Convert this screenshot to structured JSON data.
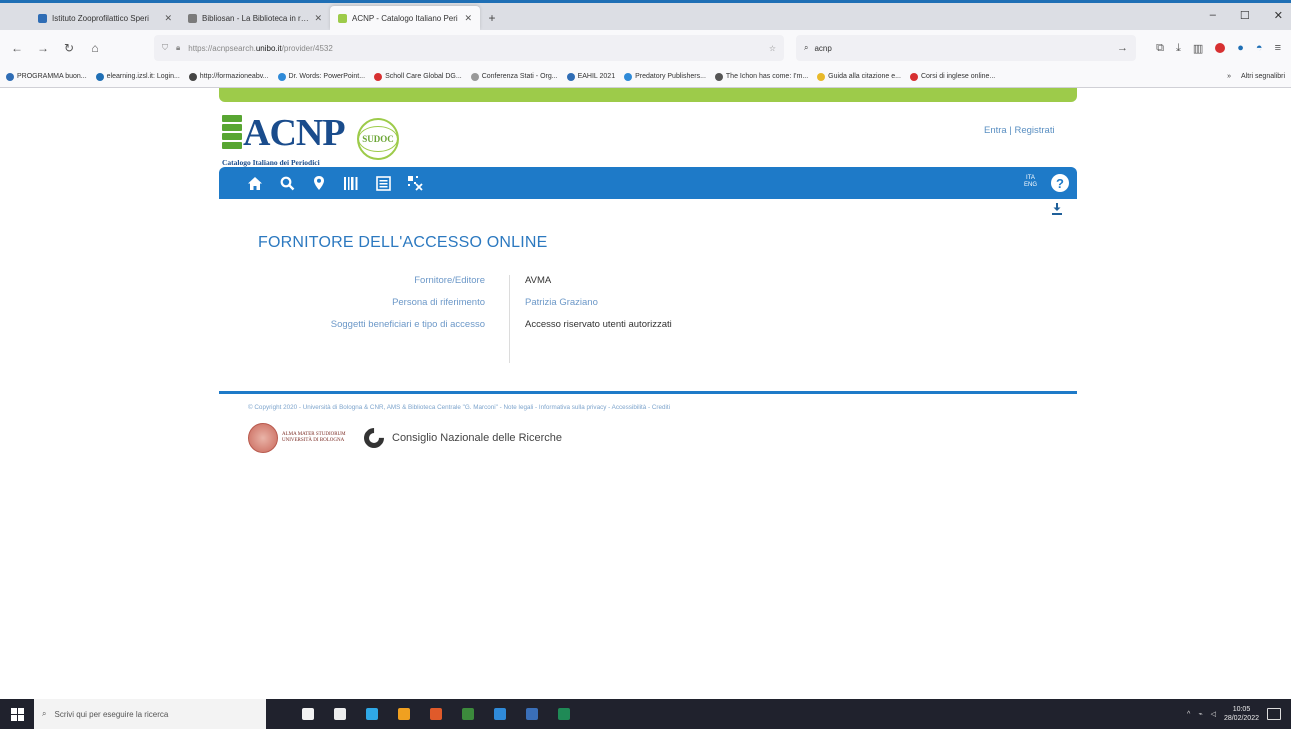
{
  "browser": {
    "tabs": [
      {
        "title": "Istituto Zooprofilattico Speri",
        "color": "#2f6db5",
        "active": false
      },
      {
        "title": "Bibliosan - La Biblioteca in rete",
        "color": "#7b7b7b",
        "active": false
      },
      {
        "title": "ACNP - Catalogo Italiano Peri",
        "color": "#9dcb4a",
        "active": true
      }
    ],
    "url_prefix": "https://acnpsearch.",
    "url_domain": "unibo.it",
    "url_suffix": "/provider/4532",
    "search_text": "acnp",
    "bookmarks": [
      {
        "label": "PROGRAMMA buon...",
        "color": "#2f6db5"
      },
      {
        "label": "elearning.izsl.it: Login...",
        "color": "#1f6fb5"
      },
      {
        "label": "http://formazioneabv...",
        "color": "#444"
      },
      {
        "label": "Dr. Words: PowerPoint...",
        "color": "#2f8ad8"
      },
      {
        "label": "Scholl Care Global DG...",
        "color": "#d73031"
      },
      {
        "label": "Conferenza Stati - Org...",
        "color": "#999"
      },
      {
        "label": "EAHIL 2021",
        "color": "#2f6db5"
      },
      {
        "label": "Predatory Publishers...",
        "color": "#2f8ad8"
      },
      {
        "label": "The Ichon has come: I'm...",
        "color": "#555"
      },
      {
        "label": "Guida alla citazione e...",
        "color": "#e8b92a"
      },
      {
        "label": "Corsi di inglese online...",
        "color": "#d73031"
      }
    ],
    "other_bookmarks": "Altri segnalibri"
  },
  "site": {
    "logo_text": "ACNP",
    "logo_seal": "SUDOC",
    "logo_tagline": "Catalogo Italiano dei Periodici",
    "login_link": "Entra | Registrati",
    "lang_top": "ITA",
    "lang_bottom": "ENG",
    "help": "?",
    "nav_icons": [
      "home-icon",
      "search-icon",
      "map-pin-icon",
      "barcode-icon",
      "list-icon",
      "qr-icon"
    ]
  },
  "content": {
    "title": "FORNITORE DELL'ACCESSO ONLINE",
    "rows": [
      {
        "key": "Fornitore/Editore",
        "value": "AVMA",
        "link": false
      },
      {
        "key": "Persona di riferimento",
        "value": "Patrizia Graziano",
        "link": true
      },
      {
        "key": "Soggetti beneficiari e tipo di accesso",
        "value": "Accesso riservato utenti autorizzati",
        "link": false
      }
    ]
  },
  "footer": {
    "copyright": "© Copyright 2020 - Università di Bologna & CNR, AMS & Biblioteca Centrale \"G. Marconi\" - Note legali - Informativa sulla privacy - Accessibilità - Crediti",
    "unibo_name": "ALMA MATER STUDIORUM UNIVERSITÀ DI BOLOGNA",
    "cnr_name": "Consiglio Nazionale delle Ricerche"
  },
  "taskbar": {
    "search_placeholder": "Scrivi qui per eseguire la ricerca",
    "time": "10:05",
    "date": "28/02/2022",
    "apps": [
      "#f2f2f2",
      "#eeeeee",
      "#2fa8e6",
      "#f0a020",
      "#e05a2a",
      "#3c8a3c",
      "#2f8ad8",
      "#3a6fb8",
      "#1f8a56"
    ]
  }
}
